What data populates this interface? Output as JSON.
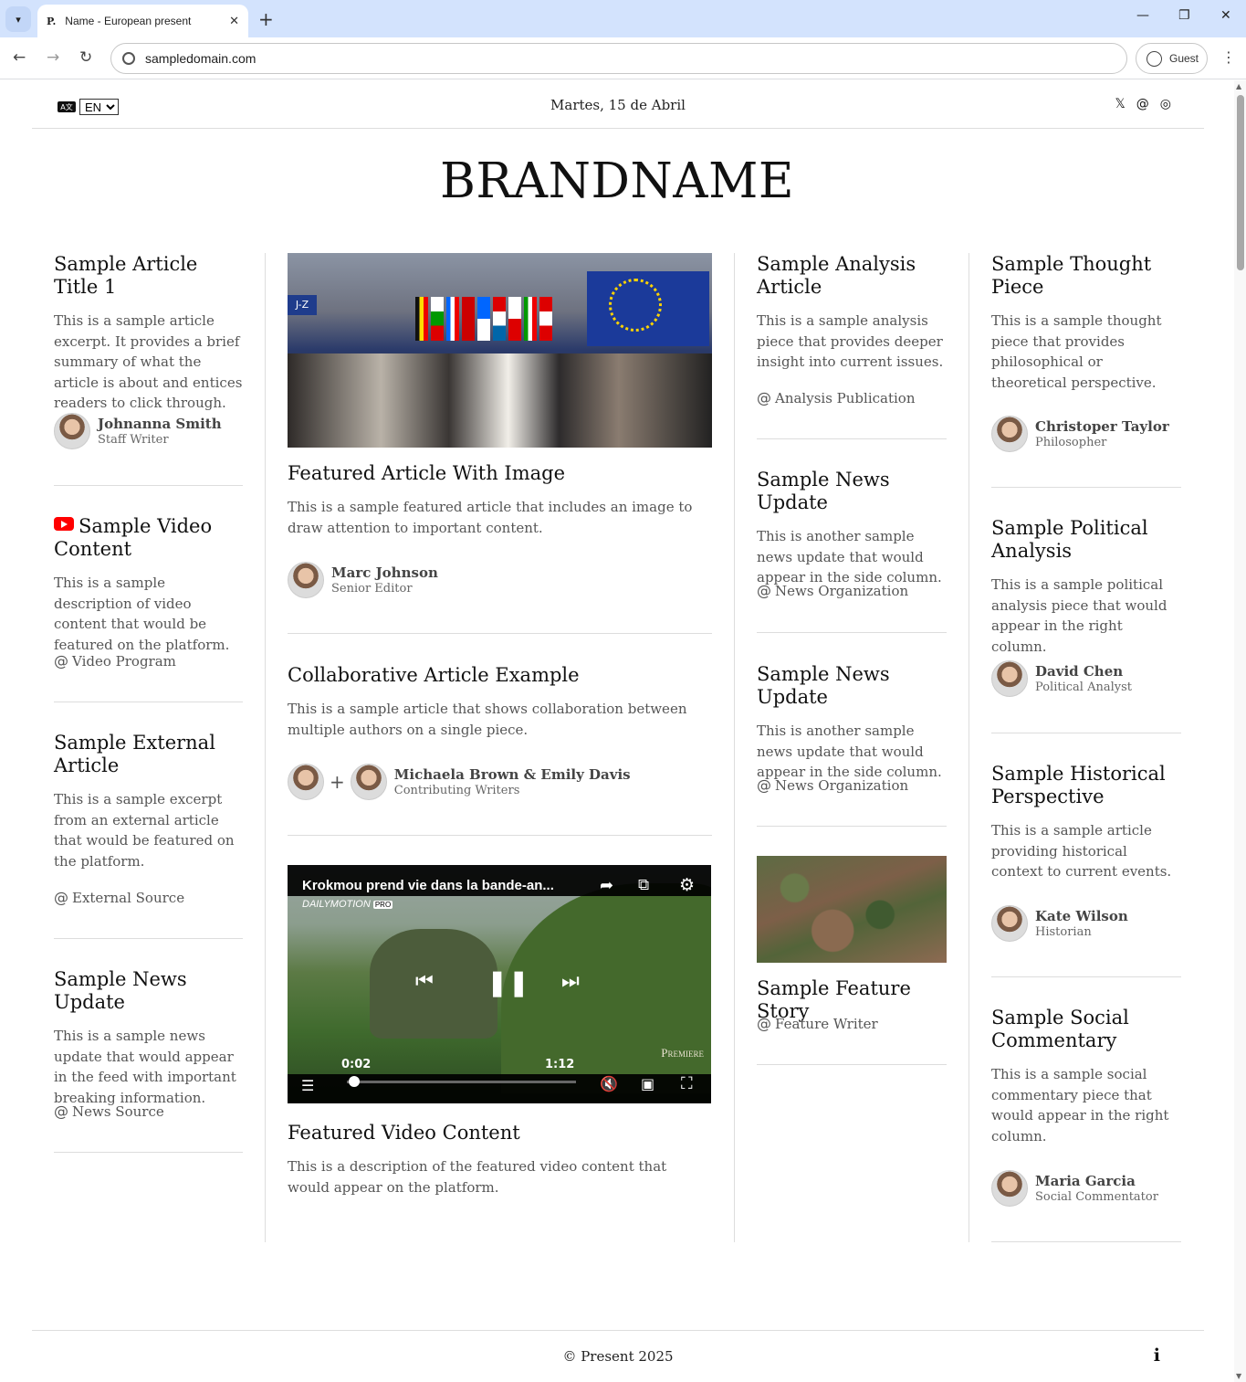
{
  "browser": {
    "tab_title": "Name - European present",
    "tab_favicon": "P.",
    "url": "sampledomain.com",
    "profile": "Guest"
  },
  "header": {
    "language": "EN",
    "language_options": [
      "EN"
    ],
    "date": "Martes, 15 de Abril",
    "social": [
      "x-icon",
      "threads-icon",
      "instagram-icon"
    ],
    "brand": "BRANDNAME"
  },
  "left_column": [
    {
      "title": "Sample Article Title 1",
      "excerpt": "This is a sample article excerpt. It provides a brief summary of what the article is about and entices readers to click through.",
      "author": "Johnanna Smith",
      "role": "Staff Writer"
    },
    {
      "title": "Sample Video Content",
      "excerpt": "This is a sample description of video content that would be featured on the platform.",
      "source": "Video Program"
    },
    {
      "title": "Sample External Article",
      "excerpt": "This is a sample excerpt from an external article that would be featured on the platform.",
      "source": "External Source"
    },
    {
      "title": "Sample News Update",
      "excerpt": "This is a sample news update that would appear in the feed with important breaking information.",
      "source": "News Source"
    }
  ],
  "center_column": [
    {
      "title": "Featured Article With Image",
      "excerpt": "This is a sample featured article that includes an image to draw attention to important content.",
      "author": "Marc Johnson",
      "role": "Senior Editor"
    },
    {
      "title": "Collaborative Article Example",
      "excerpt": "This is a sample article that shows collaboration between multiple authors on a single piece.",
      "author": "Michaela Brown & Emily Davis",
      "role": "Contributing Writers"
    },
    {
      "title": "Featured Video Content",
      "excerpt": "This is a description of the featured video content that would appear on the platform."
    }
  ],
  "video_player": {
    "title": "Krokmou prend vie dans la bande-an...",
    "provider": "DAILYMOTION",
    "provider_badge": "PRO",
    "watermark": "Premiere",
    "current_time": "0:02",
    "duration": "1:12",
    "progress": 0.03
  },
  "right_column_a": [
    {
      "title": "Sample Analysis Article",
      "excerpt": "This is a sample analysis piece that provides deeper insight into current issues.",
      "source": "Analysis Publication"
    },
    {
      "title": "Sample News Update",
      "excerpt": "This is another sample news update that would appear in the side column.",
      "source": "News Organization"
    },
    {
      "title": "Sample News Update",
      "excerpt": "This is another sample news update that would appear in the side column.",
      "source": "News Organization"
    },
    {
      "title": "Sample Feature Story",
      "source": "Feature Writer"
    }
  ],
  "right_column_b": [
    {
      "title": "Sample Thought Piece",
      "excerpt": "This is a sample thought piece that provides philosophical or theoretical perspective.",
      "author": "Christoper Taylor",
      "role": "Philosopher"
    },
    {
      "title": "Sample Political Analysis",
      "excerpt": "This is a sample political analysis piece that would appear in the right column.",
      "author": "David Chen",
      "role": "Political Analyst"
    },
    {
      "title": "Sample Historical Perspective",
      "excerpt": "This is a sample article providing historical context to current events.",
      "author": "Kate Wilson",
      "role": "Historian"
    },
    {
      "title": "Sample Social Commentary",
      "excerpt": "This is a sample social commentary piece that would appear in the right column.",
      "author": "Maria Garcia",
      "role": "Social Commentator"
    }
  ],
  "footer": {
    "copyright": "© Present 2025",
    "info": "i"
  }
}
